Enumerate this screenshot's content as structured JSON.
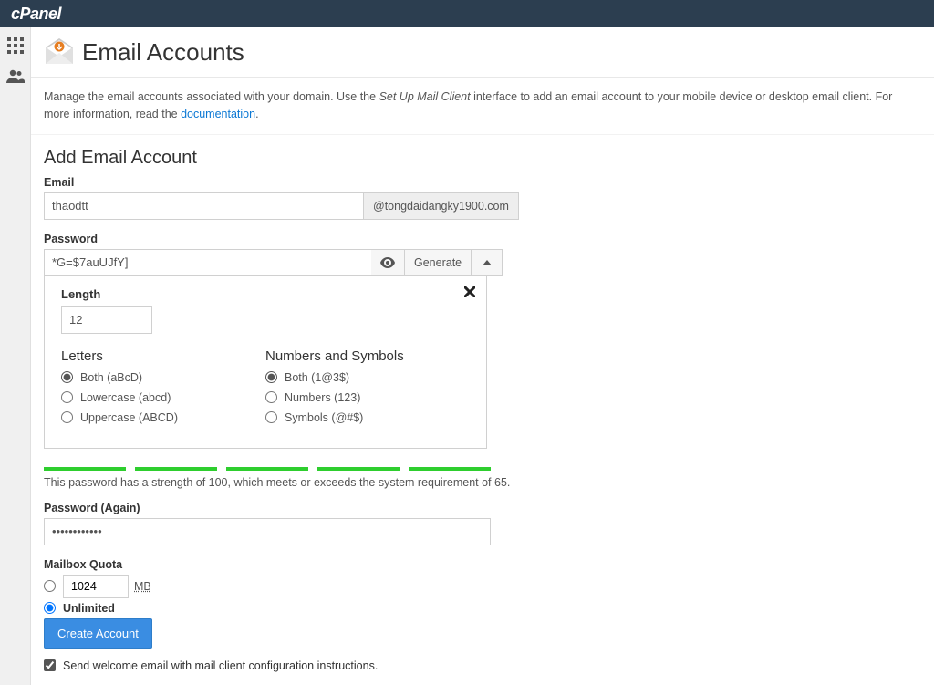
{
  "brand": "cPanel",
  "header": {
    "title": "Email Accounts"
  },
  "description": {
    "pre": "Manage the email accounts associated with your domain. Use the ",
    "em": "Set Up Mail Client",
    "mid": " interface to add an email account to your mobile device or desktop email client. For more information, read the ",
    "link": "documentation",
    "post": "."
  },
  "form": {
    "section_title": "Add Email Account",
    "email_label": "Email",
    "email_value": "thaodtt",
    "domain": "@tongdaidangky1900.com",
    "password_label": "Password",
    "password_value": "*G=$7auUJfY]",
    "generate_label": "Generate",
    "gen": {
      "length_label": "Length",
      "length_value": "12",
      "letters_title": "Letters",
      "letters": [
        {
          "label": "Both (aBcD)",
          "checked": true
        },
        {
          "label": "Lowercase (abcd)",
          "checked": false
        },
        {
          "label": "Uppercase (ABCD)",
          "checked": false
        }
      ],
      "numbers_title": "Numbers and Symbols",
      "numbers": [
        {
          "label": "Both (1@3$)",
          "checked": true
        },
        {
          "label": "Numbers (123)",
          "checked": false
        },
        {
          "label": "Symbols (@#$)",
          "checked": false
        }
      ]
    },
    "strength_text": "This password has a strength of 100, which meets or exceeds the system requirement of 65.",
    "password_again_label": "Password (Again)",
    "password_again_value": "••••••••••••",
    "quota_label": "Mailbox Quota",
    "quota_value": "1024",
    "quota_unit": "MB",
    "unlimited_label": "Unlimited",
    "create_label": "Create Account",
    "welcome_label": "Send welcome email with mail client configuration instructions."
  }
}
